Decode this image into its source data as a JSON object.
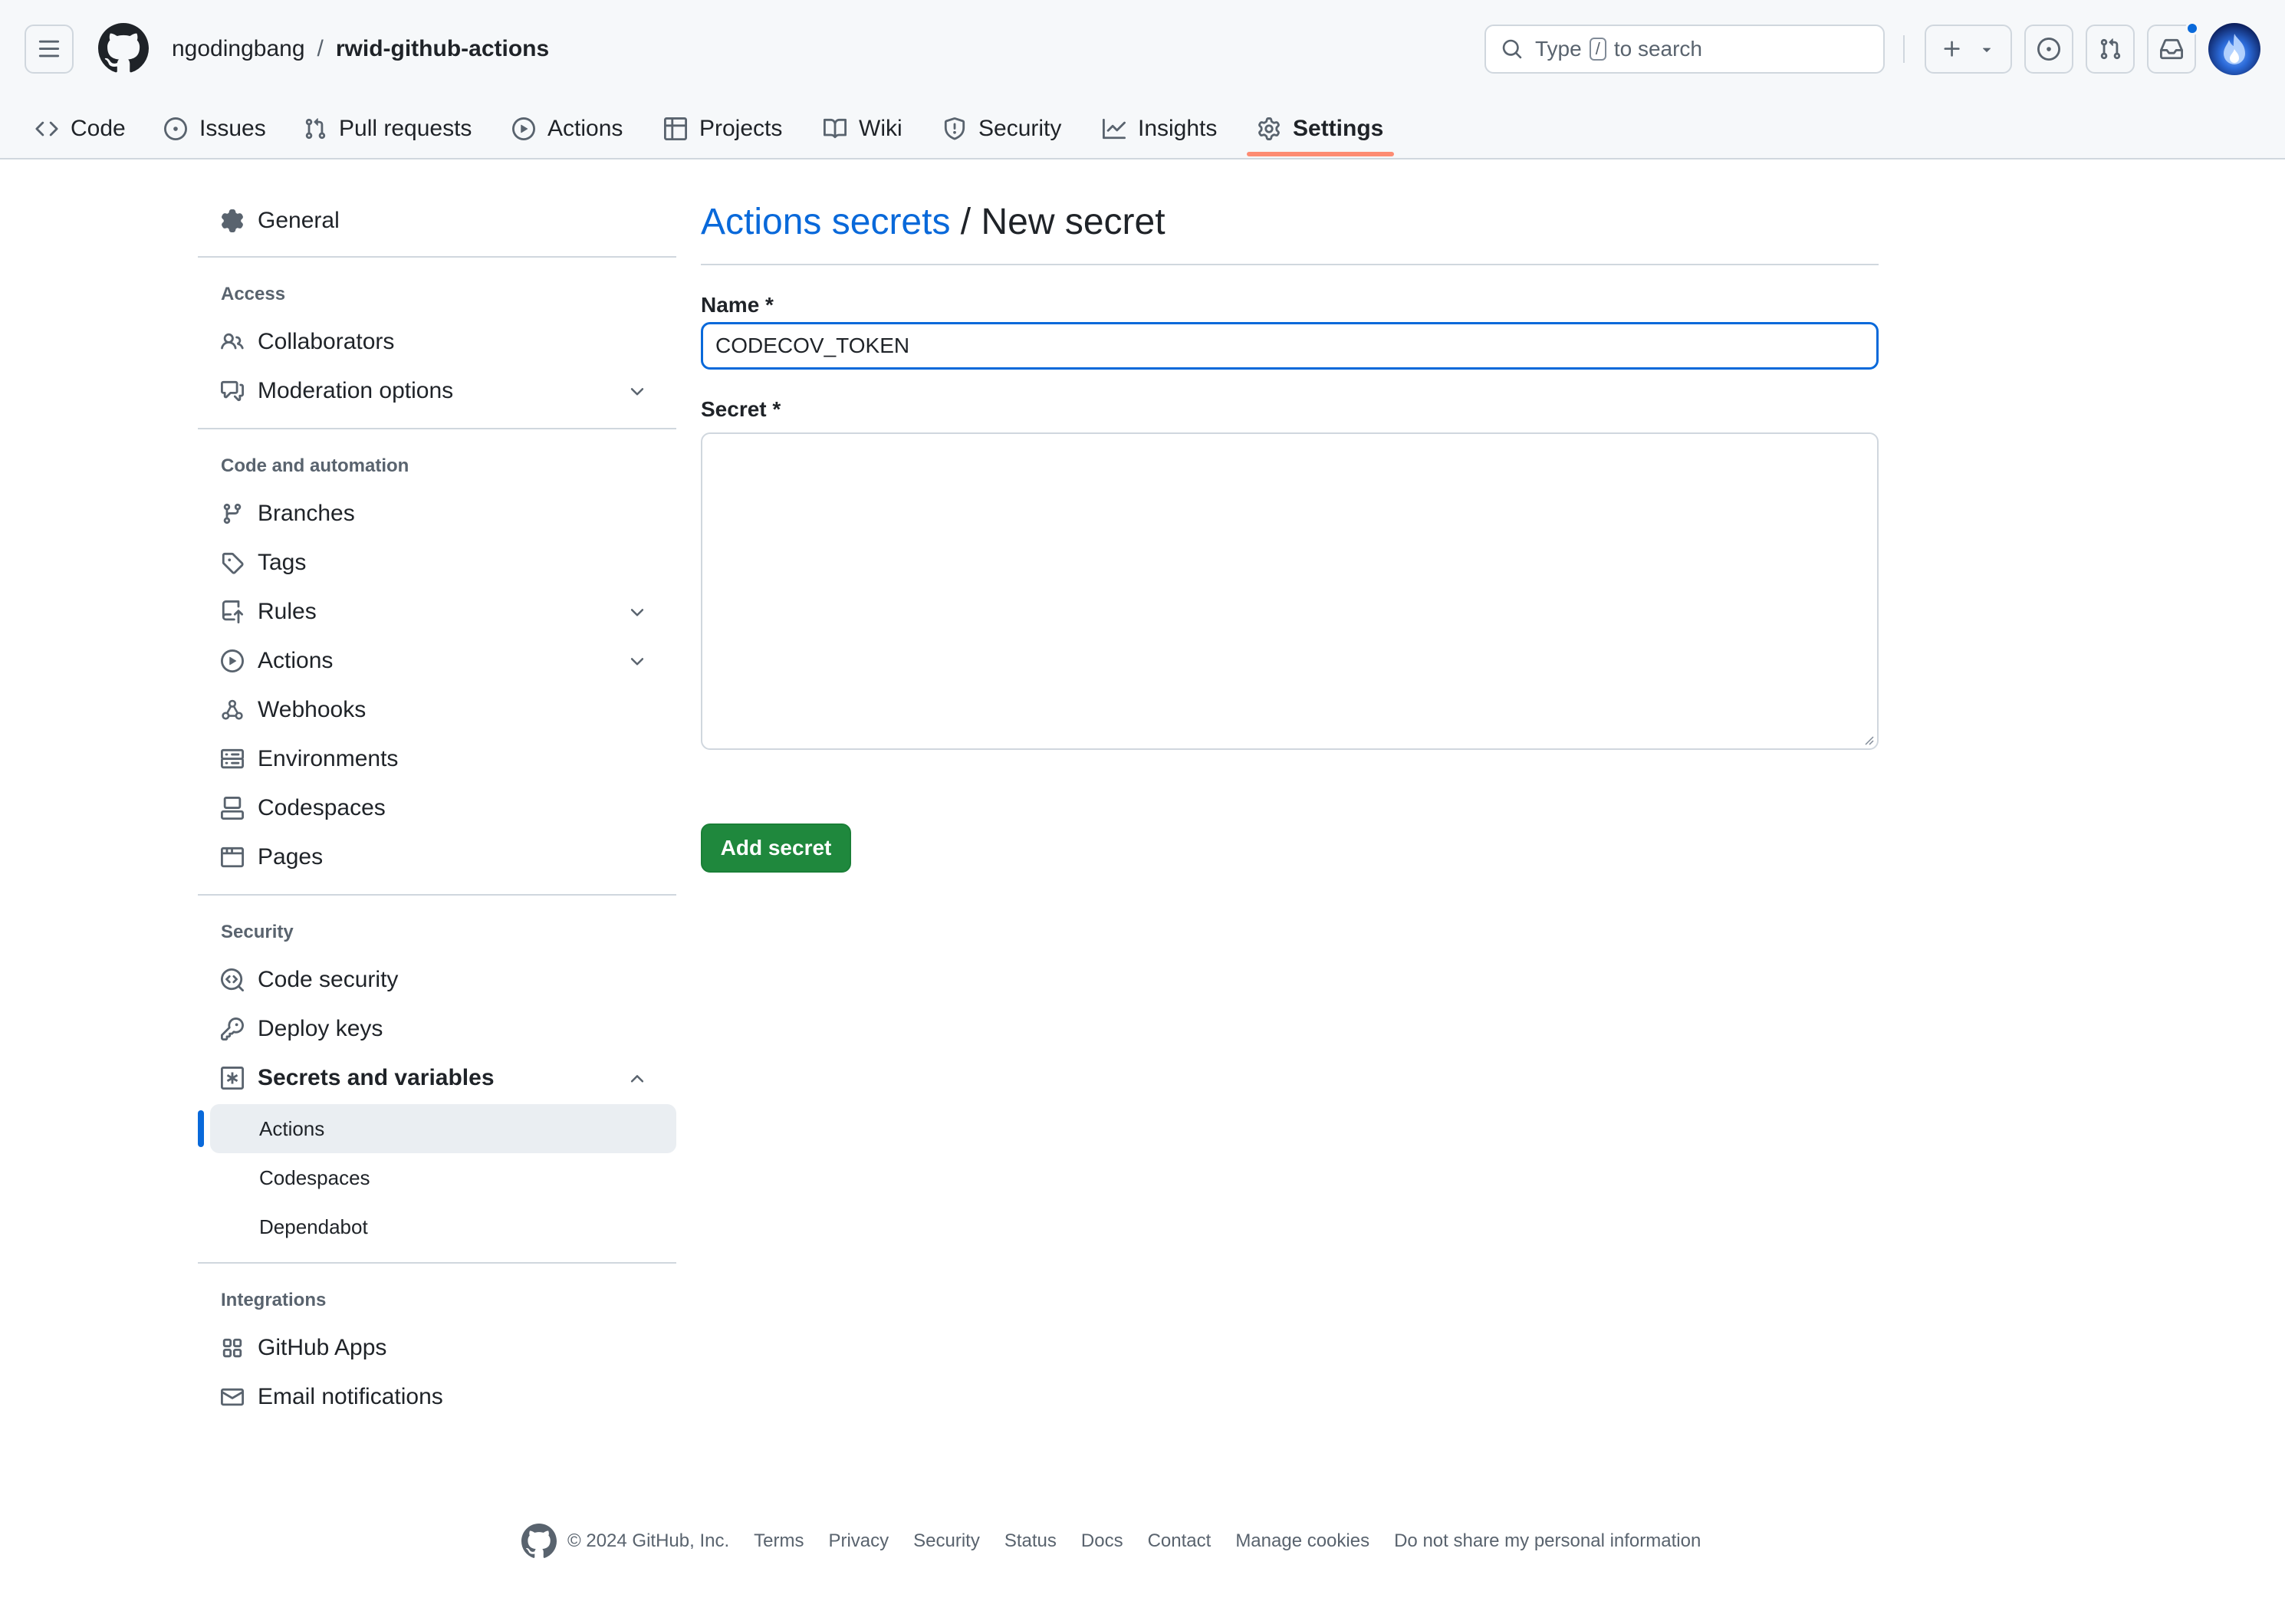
{
  "header": {
    "owner": "ngodingbang",
    "separator": "/",
    "repo": "rwid-github-actions",
    "search": {
      "prefix": "Type",
      "key": "/",
      "suffix": "to search"
    }
  },
  "tabs": [
    {
      "label": "Code",
      "icon": "code-icon"
    },
    {
      "label": "Issues",
      "icon": "issue-icon"
    },
    {
      "label": "Pull requests",
      "icon": "pull-request-icon"
    },
    {
      "label": "Actions",
      "icon": "play-icon"
    },
    {
      "label": "Projects",
      "icon": "table-icon"
    },
    {
      "label": "Wiki",
      "icon": "book-icon"
    },
    {
      "label": "Security",
      "icon": "shield-icon"
    },
    {
      "label": "Insights",
      "icon": "graph-icon"
    },
    {
      "label": "Settings",
      "icon": "gear-icon",
      "selected": true
    }
  ],
  "sidebar": {
    "general": "General",
    "access": {
      "heading": "Access",
      "items": [
        "Collaborators",
        "Moderation options"
      ]
    },
    "code": {
      "heading": "Code and automation",
      "items": [
        "Branches",
        "Tags",
        "Rules",
        "Actions",
        "Webhooks",
        "Environments",
        "Codespaces",
        "Pages"
      ]
    },
    "security": {
      "heading": "Security",
      "items": [
        "Code security",
        "Deploy keys",
        "Secrets and variables"
      ],
      "sub_items": [
        "Actions",
        "Codespaces",
        "Dependabot"
      ]
    },
    "integrations": {
      "heading": "Integrations",
      "items": [
        "GitHub Apps",
        "Email notifications"
      ]
    }
  },
  "main": {
    "breadcrumb_link": "Actions secrets",
    "breadcrumb_current": "/ New secret",
    "name_label": "Name *",
    "name_value": "CODECOV_TOKEN",
    "secret_label": "Secret *",
    "secret_value": "",
    "submit_label": "Add secret"
  },
  "footer": {
    "copyright": "© 2024 GitHub, Inc.",
    "links": [
      "Terms",
      "Privacy",
      "Security",
      "Status",
      "Docs",
      "Contact",
      "Manage cookies",
      "Do not share my personal information"
    ]
  },
  "colors": {
    "accent": "#0969da",
    "primary_button": "#1f883d",
    "selected_tab_underline": "#fd8c73",
    "muted_text": "#59636e",
    "border": "#d0d7de"
  }
}
